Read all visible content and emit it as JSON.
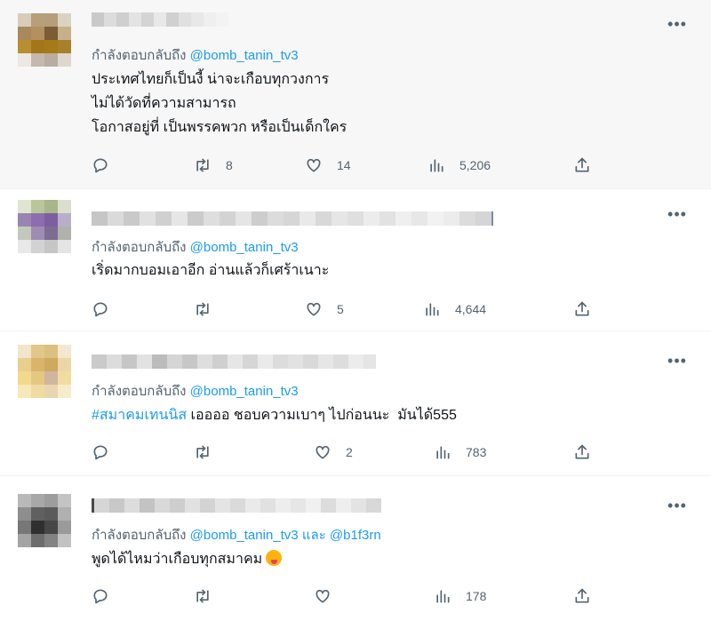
{
  "reply_prefix": "กำลังตอบกลับถึง",
  "and_word": "และ",
  "colors": {
    "accent": "#1d9bf0",
    "secondary": "#536471",
    "text": "#0f1419",
    "highlight_bg": "#f7f7f7"
  },
  "tweets": [
    {
      "replying_to": "@bomb_tanin_tv3",
      "lines": [
        "ประเทศไทยก็เป็นงี้ น่าจะเกือบทุกวงการ",
        "ไม่ได้วัดที่ความสามารถ",
        "โอกาสอยู่ที่ เป็นพรรคพวก หรือเป็นเด็กใคร"
      ],
      "retweets": "8",
      "likes": "14",
      "views": "5,206"
    },
    {
      "replying_to": "@bomb_tanin_tv3",
      "lines": [
        "เริ่ดมากบอมเอาอีก อ่านแล้วก็เศร้าเนาะ"
      ],
      "retweets": "",
      "likes": "5",
      "views": "4,644"
    },
    {
      "replying_to": "@bomb_tanin_tv3",
      "hashtag": "#สมาคมเทนนิส",
      "text_after_hashtag": " เออออ ชอบความเบาๆ ไปก่อนนะ  มันได้555",
      "retweets": "",
      "likes": "2",
      "views": "783"
    },
    {
      "replying_to": "@bomb_tanin_tv3",
      "replying_to_2": "@b1f3rn",
      "lines": [
        "พูดได้ไหมว่าเกือบทุกสมาคม"
      ],
      "emoji": "squinting-face-with-tongue",
      "retweets": "",
      "likes": "",
      "views": "178"
    }
  ],
  "icons": {
    "reply": "reply-icon",
    "retweet": "retweet-icon",
    "like": "heart-icon",
    "views": "analytics-icon",
    "share": "share-icon",
    "more": "more-icon"
  }
}
